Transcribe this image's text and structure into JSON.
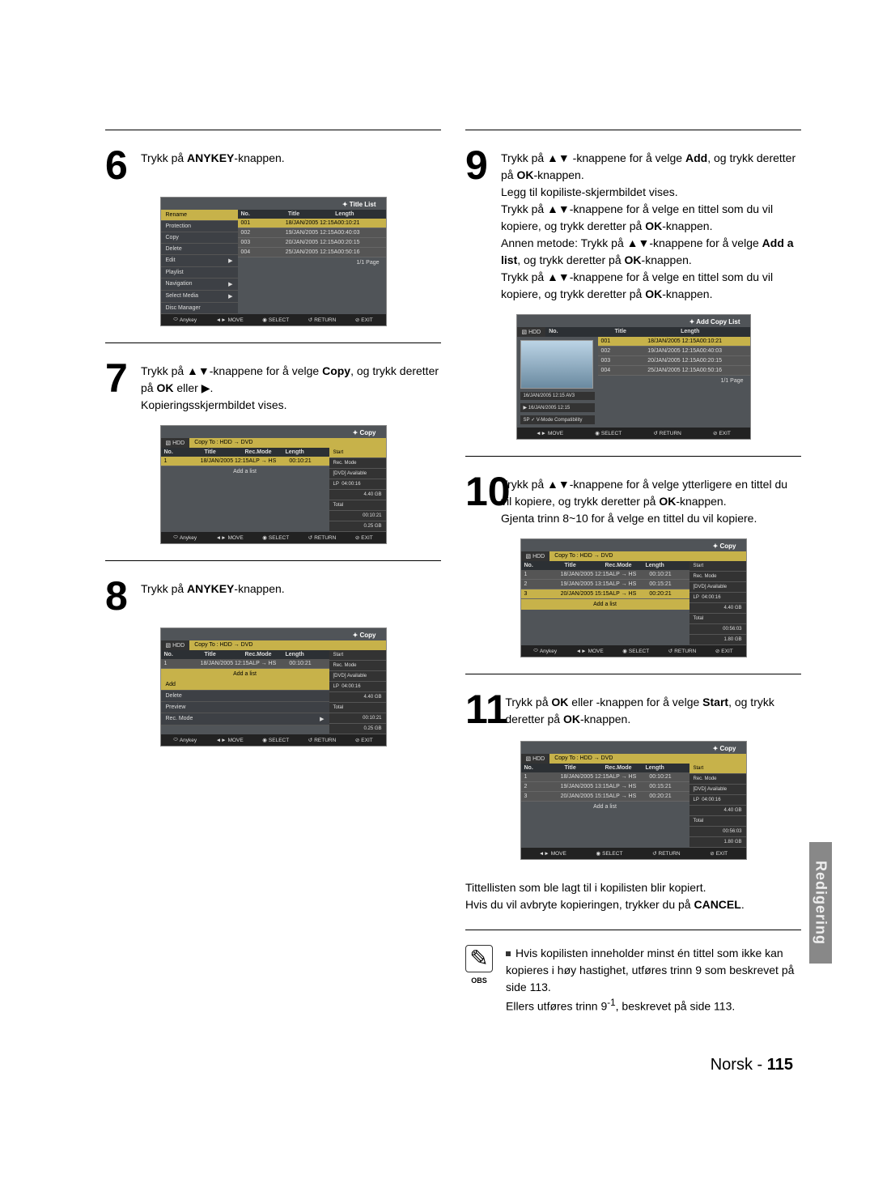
{
  "steps": {
    "s6": "Trykk på ",
    "s6b": "ANYKEY",
    "s6c": "-knappen.",
    "s7a": "Trykk på ",
    "s7b": "-knappene for å velge ",
    "s7copy": "Copy",
    "s7c": ", og trykk deretter på ",
    "s7ok": "OK",
    "s7d": " eller ▶.",
    "s7e": "Kopieringsskjermbildet vises.",
    "s8a": "Trykk på ",
    "s8b": "ANYKEY",
    "s8c": "-knappen.",
    "s9a": "Trykk på ",
    "s9b": " -knappene for å velge ",
    "s9add": "Add",
    "s9c": ", og trykk deretter på ",
    "s9ok": "OK",
    "s9d": "-knappen.",
    "s9e": "Legg til kopiliste-skjermbildet vises.",
    "s9f": "Trykk på ▲▼-knappene for å velge en tittel som du vil kopiere, og trykk deretter på ",
    "s9g": "-knappen.",
    "s9h": "Annen metode: Trykk på ▲▼-knappene for å velge ",
    "s9addl": "Add a list",
    "s9i": ", og trykk deretter på ",
    "s9j": "-knappen.",
    "s9k": "Trykk på ▲▼-knappene for å velge en tittel som du vil kopiere, og trykk deretter på ",
    "s9l": "-knappen.",
    "s10a": "Trykk på ▲▼-knappene for å velge ytterligere en tittel du vil kopiere, og trykk deretter på ",
    "s10b": "-knappen.",
    "s10c": "Gjenta trinn 8~10 for å velge en tittel du vil kopiere.",
    "s11a": "Trykk på ",
    "s11b": " eller  -knappen for å velge ",
    "s11start": "Start",
    "s11c": ", og trykk deretter på ",
    "s11d": "-knappen.",
    "aftera": "Tittellisten som ble lagt til i kopilisten blir kopiert.",
    "afterb": "Hvis du vil avbryte kopieringen, trykker du på ",
    "cancel": "CANCEL",
    "afterc": "."
  },
  "note": {
    "icon": "✎",
    "label": "OBS",
    "t1": "Hvis kopilisten inneholder minst én tittel som ikke kan kopieres i høy hastighet, utføres trinn 9 som beskrevet på side 113.",
    "t2": "Ellers utføres trinn 9",
    "t2sup": "-1",
    "t2b": ", beskrevet på side 113."
  },
  "osd": {
    "titleList": "Title List",
    "addCopyList": "Add Copy List",
    "copy": "Copy",
    "hdd": "HDD",
    "copyTo": "Copy To : HDD → DVD",
    "colsNTL": {
      "no": "No.",
      "title": "Title",
      "length": "Length"
    },
    "colsFull": {
      "no": "No.",
      "title": "Title",
      "rec": "Rec.Mode",
      "length": "Length"
    },
    "menu": [
      "Rename",
      "Protection",
      "Copy",
      "Delete",
      "Edit",
      "Playlist",
      "Navigation",
      "Select Media",
      "Disc Manager"
    ],
    "rows4": [
      {
        "n": "001",
        "t": "18/JAN/2005 12:15A",
        "l": "00:10:21"
      },
      {
        "n": "002",
        "t": "19/JAN/2005 12:15A",
        "l": "00:40:03"
      },
      {
        "n": "003",
        "t": "20/JAN/2005 12:15A",
        "l": "00:20:15"
      },
      {
        "n": "004",
        "t": "25/JAN/2005 12:15A",
        "l": "00:50:16"
      }
    ],
    "copyRow1": {
      "n": "1",
      "t": "18/JAN/2005 12:15A",
      "m": "LP → HS",
      "l": "00:10:21"
    },
    "copyRows3": [
      {
        "n": "1",
        "t": "18/JAN/2005 12:15A",
        "m": "LP → HS",
        "l": "00:10:21"
      },
      {
        "n": "2",
        "t": "19/JAN/2005 13:15A",
        "m": "LP → HS",
        "l": "00:15:21"
      },
      {
        "n": "3",
        "t": "20/JAN/2005 15:15A",
        "m": "LP → HS",
        "l": "00:20:21"
      }
    ],
    "addAList": "Add a list",
    "sideMenu8": [
      "Add",
      "Delete",
      "Preview",
      "Rec. Mode"
    ],
    "side": {
      "start": "Start",
      "recmode": "Rec. Mode",
      "dvdavail": "[DVD] Available",
      "lp": "LP",
      "cap1": "04:00:16",
      "cap2": "4.40 GB",
      "total": "Total",
      "tot1": "00:10:21",
      "tot2": "0.25 GB",
      "tot3a": "00:56:03",
      "tot3b": "1.80 GB"
    },
    "pv": {
      "l1": "16/JAN/2005 12:15 AV3",
      "l2": "16/JAN/2005 12:15",
      "l3": "SP ✓ V-Mode Compatibility"
    },
    "page": "1/1 Page",
    "footer": {
      "anykey": "Anykey",
      "move": "MOVE",
      "select": "SELECT",
      "return": "RETURN",
      "exit": "EXIT"
    }
  },
  "sidetab": "Redigering",
  "footer": {
    "lang": "Norsk",
    "sep": " - ",
    "page": "115"
  }
}
